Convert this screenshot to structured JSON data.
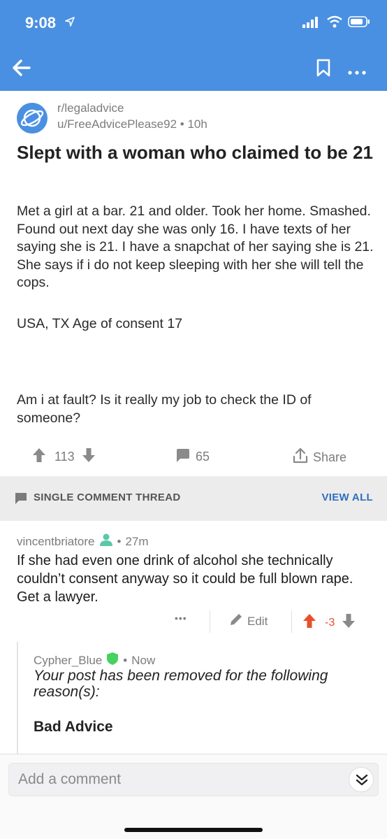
{
  "status_bar": {
    "time": "9:08"
  },
  "post": {
    "subreddit": "r/legaladvice",
    "author": "u/FreeAdvicePlease92",
    "age": "10h",
    "title": "Slept with a woman who claimed to be 21",
    "body": [
      "Met a girl at a bar. 21 and older. Took her home. Smashed. Found out next day she was only 16. I have texts of her saying she is 21. I have a snapchat of her saying she is 21. She says if i do not keep sleeping with her she will tell the cops.",
      "USA, TX Age of consent 17",
      "Am i at fault? Is it really my job to check the ID of someone?"
    ],
    "score": "113",
    "comments": "65",
    "share_label": "Share"
  },
  "thread_bar": {
    "label": "SINGLE COMMENT THREAD",
    "view_all": "VIEW ALL"
  },
  "comment": {
    "author": "vincentbriatore",
    "age": "27m",
    "body": "If she had even one drink of alcohol she technically couldn’t consent anyway so it could be full blown rape. Get a lawyer.",
    "more": "•••",
    "edit_label": "Edit",
    "score": "-3"
  },
  "reply": {
    "author": "Cypher_Blue",
    "age": "Now",
    "removed_text": "Your post has been removed for the following reason(s):",
    "reason": "Bad Advice"
  },
  "composer": {
    "placeholder": "Add a comment"
  },
  "colors": {
    "brand_blue": "#4a90e2",
    "downvote_orange": "#e8502b",
    "mod_green": "#46d160",
    "link_blue": "#2f6fbf"
  }
}
